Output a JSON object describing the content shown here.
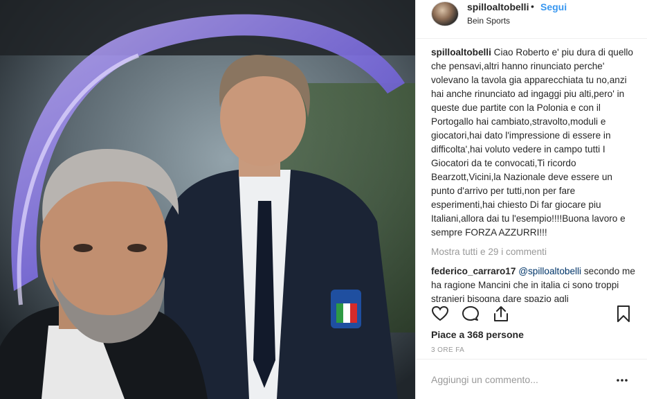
{
  "post": {
    "username": "spilloaltobelli",
    "separator": "•",
    "follow_label": "Segui",
    "location": "Bein Sports",
    "caption": "Ciao Roberto e' piu dura di quello che pensavi,altri hanno rinunciato perche' volevano la tavola gia apparecchiata tu no,anzi hai anche rinunciato ad ingaggi piu alti,pero' in queste due partite con la Polonia e con il Portogallo hai cambiato,stravolto,moduli e giocatori,hai dato l'impressione di essere in difficolta',hai voluto vedere in campo tutti I Giocatori da te convocati,Ti ricordo Bearzott,Vicini,la Nazionale deve essere un punto d'arrivo per tutti,non per fare esperimenti,hai chiesto Di far giocare piu Italiani,allora dai tu l'esempio!!!!Buona lavoro e sempre FORZA AZZURRI!!!",
    "view_all_comments": "Mostra tutti e 29 i commenti",
    "comments": [
      {
        "username": "federico_carraro17",
        "mention": "@spilloaltobelli",
        "text": "secondo me ha ragione Mancini che in italia ci sono troppi stranieri bisogna dare spazio agli"
      }
    ],
    "likes_label": "Piace a 368 persone",
    "time_label": "3 ORE FA",
    "comment_placeholder": "Aggiungi un commento...",
    "icons": [
      "heart-icon",
      "comment-icon",
      "share-icon",
      "bookmark-icon",
      "more-options-icon"
    ],
    "colors": {
      "link": "#3897f0",
      "text": "#262626",
      "muted": "#999999",
      "border": "#efefef"
    }
  }
}
